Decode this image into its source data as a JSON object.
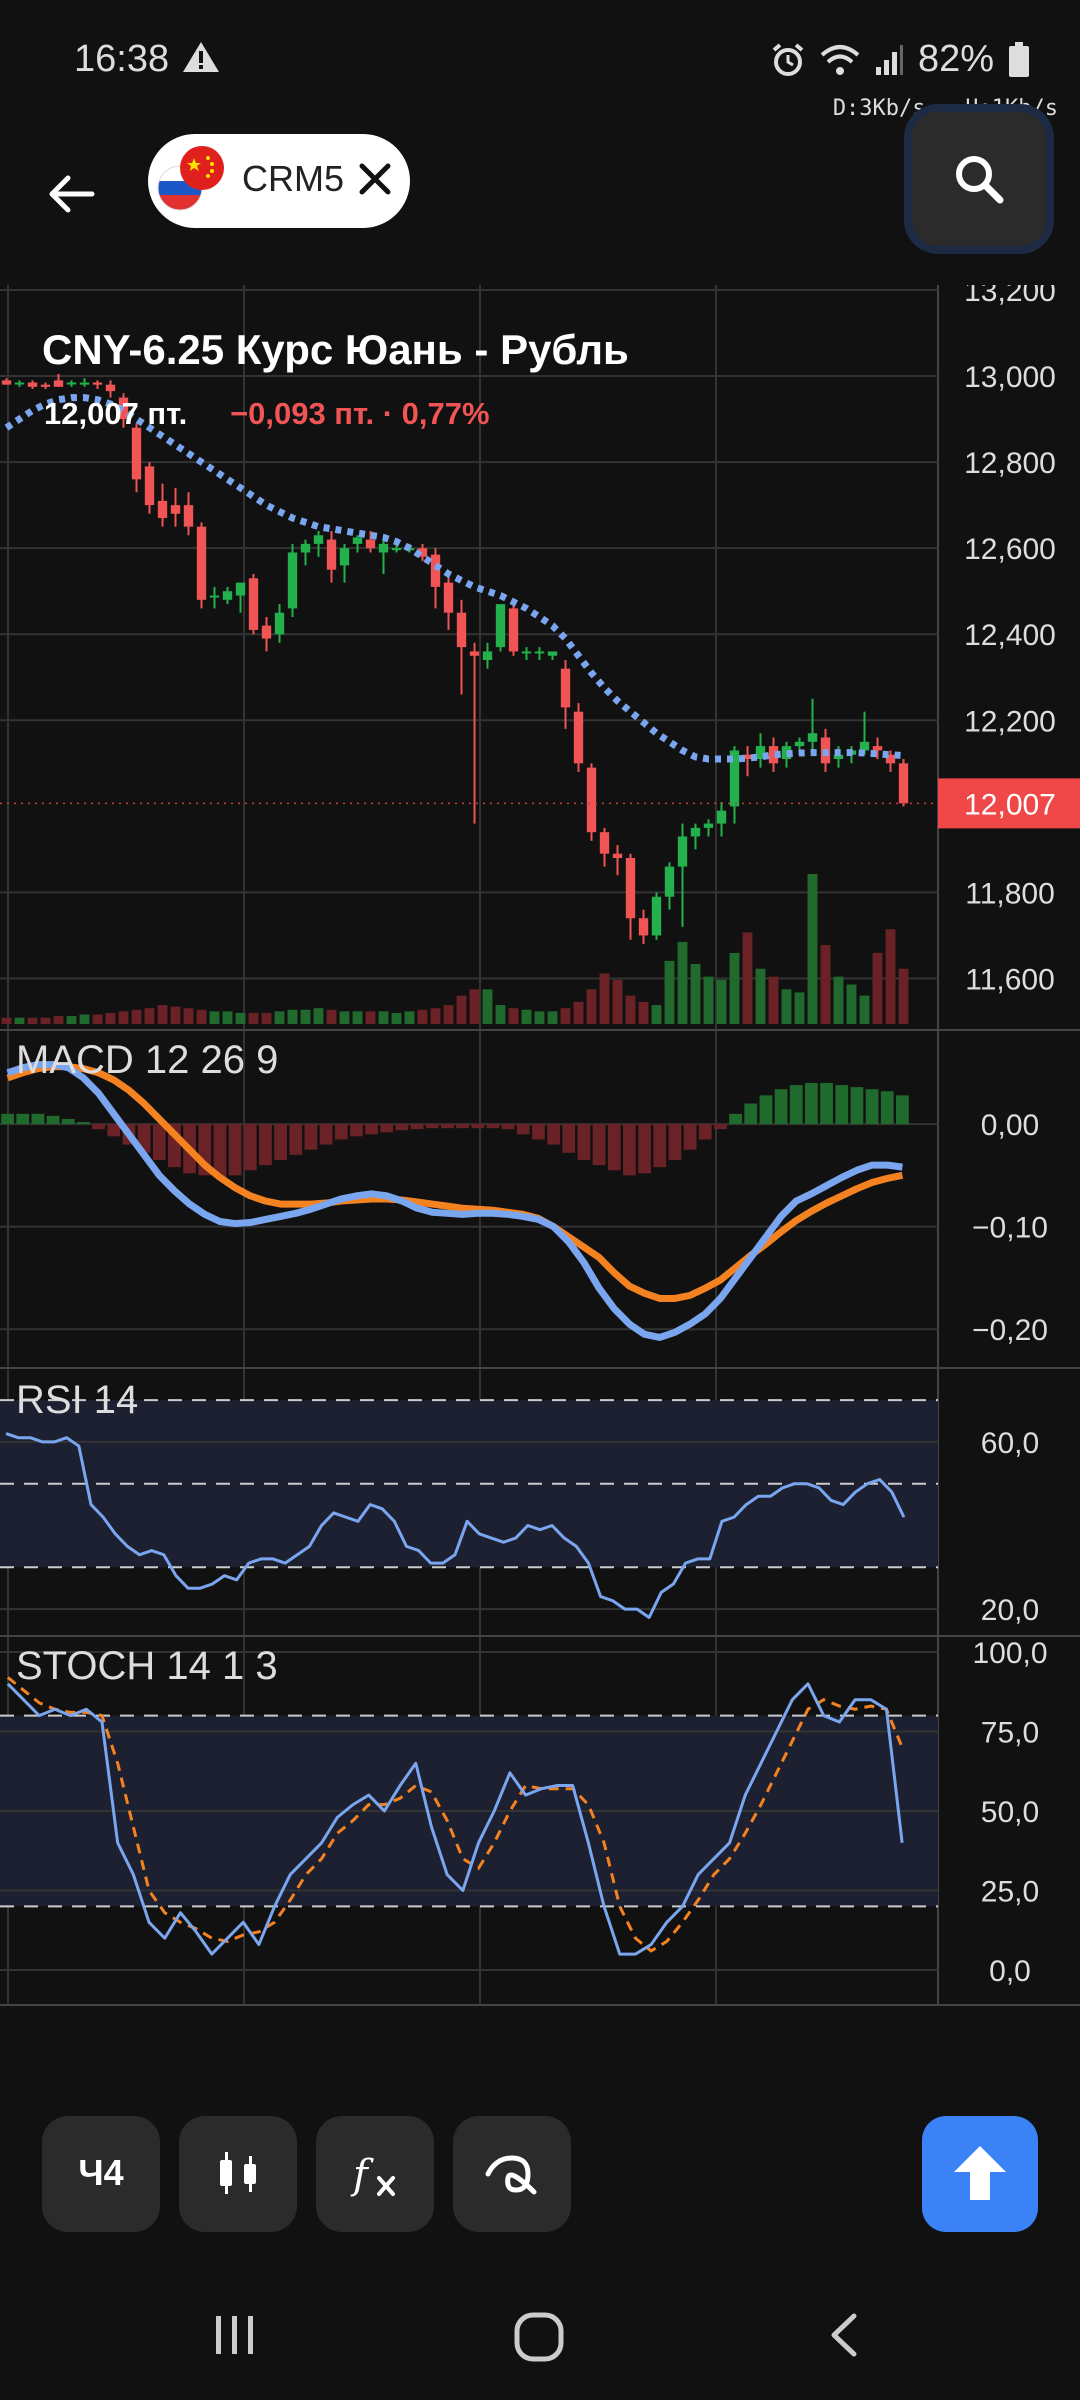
{
  "status": {
    "time": "16:38",
    "battery": "82%",
    "download": "D:3Kb/s",
    "upload": "U:1Kb/s"
  },
  "header": {
    "symbol": "CRM5"
  },
  "instrument": {
    "title": "CNY-6.25 Курс Юань - Рубль",
    "price": "12,007 пт.",
    "change": "−0,093 пт. · 0,77%"
  },
  "colors": {
    "up": "#22b14c",
    "down": "#f05454",
    "ma": "#7aa6f0",
    "macd": "#7aa6f0",
    "signal": "#f58220",
    "current_price_bg": "#f04848",
    "accent": "#3b82f6"
  },
  "toolbar": {
    "interval": "Ч4",
    "candles_icon": "candles-icon",
    "fx_icon": "function-icon",
    "draw_icon": "draw-icon",
    "up_icon": "arrow-up-icon"
  },
  "chart_data": [
    {
      "type": "candlestick",
      "current_price_label": "12,007",
      "y_ticks": [
        "13,200",
        "13,000",
        "12,800",
        "12,600",
        "12,400",
        "12,200",
        "11,800",
        "11,600"
      ],
      "ylim": [
        11550,
        13200
      ],
      "x_ticks": [
        "6",
        "11",
        "14",
        "19"
      ],
      "candles": [
        [
          12990,
          12995,
          12980,
          12980
        ],
        [
          12985,
          12990,
          12975,
          12985
        ],
        [
          12985,
          12990,
          12970,
          12975
        ],
        [
          12980,
          12985,
          12970,
          12975
        ],
        [
          12990,
          13005,
          12975,
          12975
        ],
        [
          12985,
          12990,
          12975,
          12985
        ],
        [
          12980,
          12995,
          12975,
          12985
        ],
        [
          12985,
          12990,
          12970,
          12980
        ],
        [
          12980,
          12990,
          12950,
          12965
        ],
        [
          12950,
          12960,
          12880,
          12900
        ],
        [
          12880,
          12890,
          12730,
          12760
        ],
        [
          12790,
          12800,
          12680,
          12700
        ],
        [
          12710,
          12750,
          12650,
          12670
        ],
        [
          12700,
          12740,
          12650,
          12680
        ],
        [
          12700,
          12730,
          12630,
          12650
        ],
        [
          12650,
          12660,
          12460,
          12480
        ],
        [
          12490,
          12510,
          12460,
          12490
        ],
        [
          12480,
          12510,
          12470,
          12500
        ],
        [
          12490,
          12520,
          12450,
          12520
        ],
        [
          12530,
          12540,
          12400,
          12410
        ],
        [
          12420,
          12440,
          12360,
          12390
        ],
        [
          12400,
          12470,
          12380,
          12450
        ],
        [
          12460,
          12610,
          12440,
          12590
        ],
        [
          12590,
          12620,
          12560,
          12610
        ],
        [
          12610,
          12640,
          12580,
          12630
        ],
        [
          12620,
          12640,
          12520,
          12550
        ],
        [
          12560,
          12610,
          12520,
          12600
        ],
        [
          12610,
          12630,
          12590,
          12625
        ],
        [
          12620,
          12640,
          12590,
          12600
        ],
        [
          12590,
          12620,
          12540,
          12610
        ],
        [
          12600,
          12610,
          12590,
          12600
        ],
        [
          12595,
          12610,
          12590,
          12600
        ],
        [
          12600,
          12610,
          12570,
          12580
        ],
        [
          12585,
          12600,
          12460,
          12510
        ],
        [
          12520,
          12540,
          12410,
          12450
        ],
        [
          12450,
          12480,
          12260,
          12370
        ],
        [
          12360,
          12380,
          11960,
          12350
        ],
        [
          12340,
          12380,
          12320,
          12360
        ],
        [
          12370,
          12460,
          12360,
          12470
        ],
        [
          12460,
          12480,
          12350,
          12360
        ],
        [
          12360,
          12370,
          12340,
          12360
        ],
        [
          12360,
          12370,
          12340,
          12360
        ],
        [
          12350,
          12360,
          12340,
          12360
        ],
        [
          12320,
          12340,
          12180,
          12230
        ],
        [
          12220,
          12240,
          12080,
          12100
        ],
        [
          12090,
          12100,
          11920,
          11940
        ],
        [
          11940,
          11950,
          11860,
          11890
        ],
        [
          11890,
          11910,
          11840,
          11880
        ],
        [
          11880,
          11890,
          11690,
          11740
        ],
        [
          11740,
          11760,
          11680,
          11700
        ],
        [
          11700,
          11800,
          11690,
          11790
        ],
        [
          11790,
          11870,
          11760,
          11860
        ],
        [
          11860,
          11960,
          11720,
          11930
        ],
        [
          11930,
          11960,
          11900,
          11950
        ],
        [
          11950,
          11970,
          11930,
          11960
        ],
        [
          11960,
          12010,
          11930,
          11990
        ],
        [
          12000,
          12140,
          11960,
          12130
        ],
        [
          12120,
          12140,
          12070,
          12110
        ],
        [
          12110,
          12170,
          12090,
          12140
        ],
        [
          12140,
          12160,
          12080,
          12100
        ],
        [
          12110,
          12150,
          12090,
          12140
        ],
        [
          12140,
          12160,
          12120,
          12150
        ],
        [
          12150,
          12250,
          12130,
          12170
        ],
        [
          12160,
          12180,
          12080,
          12100
        ],
        [
          12110,
          12140,
          12090,
          12120
        ],
        [
          12120,
          12140,
          12100,
          12130
        ],
        [
          12130,
          12220,
          12120,
          12150
        ],
        [
          12140,
          12160,
          12110,
          12130
        ],
        [
          12120,
          12130,
          12080,
          12100
        ],
        [
          12100,
          12110,
          12000,
          12007
        ]
      ],
      "ma": [
        12880,
        12900,
        12920,
        12935,
        12945,
        12950,
        12950,
        12945,
        12935,
        12920,
        12900,
        12880,
        12860,
        12840,
        12820,
        12800,
        12780,
        12760,
        12740,
        12720,
        12700,
        12685,
        12670,
        12660,
        12650,
        12645,
        12640,
        12635,
        12630,
        12625,
        12615,
        12600,
        12580,
        12560,
        12540,
        12525,
        12510,
        12500,
        12490,
        12475,
        12460,
        12440,
        12420,
        12390,
        12350,
        12310,
        12275,
        12245,
        12220,
        12195,
        12170,
        12150,
        12130,
        12115,
        12110,
        12110,
        12110,
        12112,
        12115,
        12120,
        12122,
        12124,
        12125,
        12125,
        12125,
        12125,
        12124,
        12122,
        12120,
        12118
      ],
      "volume": [
        4,
        4,
        4,
        4,
        5,
        5,
        6,
        6,
        7,
        8,
        9,
        10,
        12,
        11,
        10,
        9,
        8,
        8,
        7,
        7,
        7,
        8,
        9,
        9,
        10,
        9,
        8,
        8,
        8,
        8,
        7,
        8,
        9,
        10,
        12,
        18,
        22,
        22,
        12,
        10,
        9,
        8,
        8,
        10,
        14,
        22,
        32,
        28,
        18,
        14,
        12,
        40,
        52,
        38,
        30,
        28,
        45,
        58,
        35,
        30,
        22,
        20,
        95,
        50,
        30,
        25,
        18,
        45,
        60,
        35
      ]
    },
    {
      "type": "macd",
      "label": "MACD 12 26 9",
      "y_ticks": [
        "0,00",
        "−0,10",
        "−0,20"
      ],
      "ylim": [
        -0.23,
        0.08
      ],
      "macd": [
        0.05,
        0.055,
        0.058,
        0.058,
        0.055,
        0.045,
        0.03,
        0.01,
        -0.01,
        -0.03,
        -0.05,
        -0.065,
        -0.078,
        -0.088,
        -0.095,
        -0.097,
        -0.096,
        -0.093,
        -0.09,
        -0.087,
        -0.083,
        -0.078,
        -0.073,
        -0.07,
        -0.068,
        -0.07,
        -0.075,
        -0.082,
        -0.086,
        -0.087,
        -0.088,
        -0.087,
        -0.087,
        -0.088,
        -0.09,
        -0.093,
        -0.1,
        -0.115,
        -0.135,
        -0.16,
        -0.18,
        -0.195,
        -0.205,
        -0.208,
        -0.203,
        -0.195,
        -0.185,
        -0.17,
        -0.15,
        -0.13,
        -0.11,
        -0.09,
        -0.075,
        -0.068,
        -0.06,
        -0.052,
        -0.045,
        -0.04,
        -0.04,
        -0.042
      ],
      "signal": [
        0.045,
        0.05,
        0.054,
        0.056,
        0.056,
        0.054,
        0.05,
        0.043,
        0.033,
        0.02,
        0.005,
        -0.01,
        -0.025,
        -0.04,
        -0.052,
        -0.062,
        -0.07,
        -0.075,
        -0.078,
        -0.078,
        -0.078,
        -0.077,
        -0.075,
        -0.074,
        -0.073,
        -0.073,
        -0.074,
        -0.076,
        -0.078,
        -0.08,
        -0.082,
        -0.083,
        -0.084,
        -0.086,
        -0.088,
        -0.092,
        -0.1,
        -0.11,
        -0.12,
        -0.13,
        -0.145,
        -0.158,
        -0.165,
        -0.17,
        -0.17,
        -0.167,
        -0.16,
        -0.152,
        -0.14,
        -0.128,
        -0.117,
        -0.105,
        -0.094,
        -0.085,
        -0.077,
        -0.07,
        -0.063,
        -0.057,
        -0.053,
        -0.05
      ],
      "histogram": [
        0.01,
        0.01,
        0.01,
        0.008,
        0.005,
        0.002,
        -0.005,
        -0.012,
        -0.02,
        -0.028,
        -0.035,
        -0.042,
        -0.048,
        -0.05,
        -0.052,
        -0.05,
        -0.045,
        -0.04,
        -0.035,
        -0.03,
        -0.025,
        -0.02,
        -0.015,
        -0.012,
        -0.01,
        -0.008,
        -0.006,
        -0.005,
        -0.004,
        -0.004,
        -0.004,
        -0.004,
        -0.004,
        -0.005,
        -0.01,
        -0.015,
        -0.02,
        -0.028,
        -0.035,
        -0.04,
        -0.045,
        -0.05,
        -0.048,
        -0.042,
        -0.035,
        -0.025,
        -0.015,
        -0.005,
        0.01,
        0.02,
        0.028,
        0.034,
        0.038,
        0.04,
        0.04,
        0.038,
        0.036,
        0.034,
        0.032,
        0.028
      ]
    },
    {
      "type": "rsi",
      "label": "RSI 14",
      "y_ticks": [
        "60,0",
        "20,0"
      ],
      "ylim": [
        15,
        76
      ],
      "levels": [
        70,
        50,
        30
      ],
      "values": [
        62,
        61,
        61,
        60,
        60,
        61,
        59,
        45,
        42,
        38,
        35,
        33,
        34,
        33,
        28,
        25,
        25,
        26,
        28,
        27,
        31,
        32,
        32,
        31,
        33,
        35,
        40,
        43,
        42,
        41,
        45,
        44,
        41,
        35,
        34,
        31,
        31,
        33,
        41,
        38,
        37,
        36,
        37,
        40,
        39,
        40,
        37,
        35,
        31,
        23,
        22,
        20,
        20,
        18,
        24,
        26,
        31,
        32,
        32,
        41,
        42,
        45,
        47,
        47,
        49,
        50,
        50,
        49,
        46,
        45,
        48,
        50,
        51,
        48,
        42
      ]
    },
    {
      "type": "stochastic",
      "label": "STOCH 14 1 3",
      "y_ticks": [
        "100,0",
        "75,0",
        "50,0",
        "25,0",
        "0,0"
      ],
      "ylim": [
        -10,
        100
      ],
      "levels": [
        80,
        20
      ],
      "k": [
        90,
        85,
        80,
        82,
        80,
        82,
        78,
        40,
        30,
        15,
        10,
        18,
        12,
        5,
        10,
        15,
        8,
        20,
        30,
        35,
        40,
        48,
        52,
        55,
        50,
        58,
        65,
        45,
        30,
        25,
        40,
        50,
        62,
        55,
        57,
        58,
        58,
        40,
        20,
        5,
        5,
        8,
        15,
        20,
        30,
        35,
        40,
        55,
        65,
        75,
        85,
        90,
        80,
        78,
        85,
        85,
        82,
        40
      ],
      "d": [
        92,
        88,
        84,
        82,
        81,
        81,
        80,
        65,
        45,
        25,
        18,
        15,
        13,
        10,
        9,
        11,
        12,
        15,
        22,
        30,
        35,
        43,
        47,
        52,
        52,
        54,
        58,
        56,
        47,
        35,
        32,
        40,
        50,
        58,
        57,
        57,
        57,
        52,
        40,
        20,
        10,
        6,
        9,
        15,
        22,
        30,
        35,
        43,
        52,
        62,
        72,
        82,
        85,
        83,
        82,
        83,
        82,
        70
      ]
    }
  ]
}
